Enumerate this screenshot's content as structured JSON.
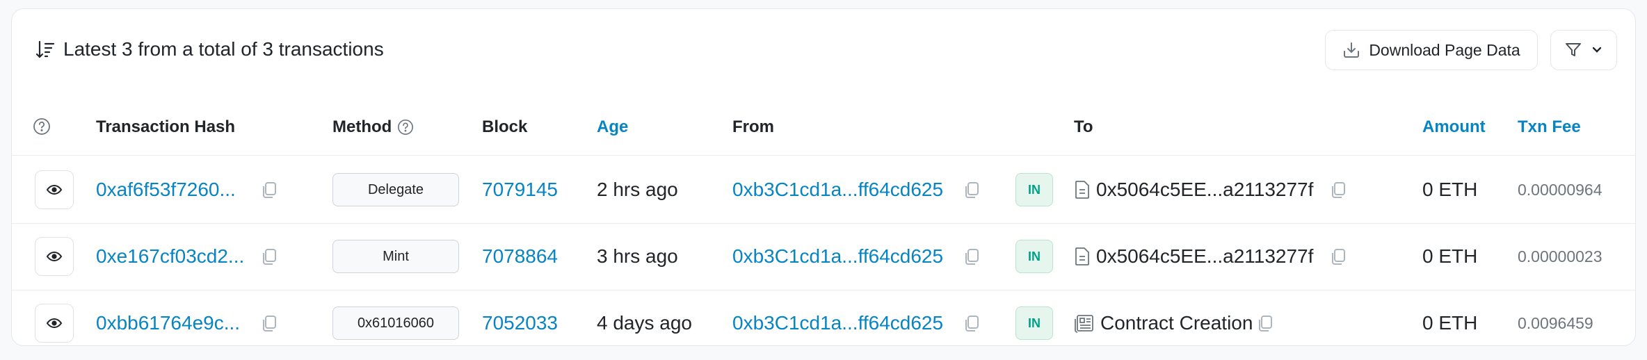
{
  "header": {
    "title": "Latest 3 from a total of 3 transactions",
    "download_label": "Download Page Data"
  },
  "columns": {
    "tx_hash": "Transaction Hash",
    "method": "Method",
    "block": "Block",
    "age": "Age",
    "from": "From",
    "to": "To",
    "amount": "Amount",
    "txn_fee": "Txn Fee"
  },
  "rows": [
    {
      "hash": "0xaf6f53f7260...",
      "method": "Delegate",
      "block": "7079145",
      "age": "2 hrs ago",
      "from": "0xb3C1cd1a...ff64cd625",
      "direction": "IN",
      "to": "0x5064c5EE...a2113277f",
      "to_type": "contract",
      "amount": "0 ETH",
      "fee": "0.00000964"
    },
    {
      "hash": "0xe167cf03cd2...",
      "method": "Mint",
      "block": "7078864",
      "age": "3 hrs ago",
      "from": "0xb3C1cd1a...ff64cd625",
      "direction": "IN",
      "to": "0x5064c5EE...a2113277f",
      "to_type": "contract",
      "amount": "0 ETH",
      "fee": "0.00000023"
    },
    {
      "hash": "0xbb61764e9c...",
      "method": "0x61016060",
      "block": "7052033",
      "age": "4 days ago",
      "from": "0xb3C1cd1a...ff64cd625",
      "direction": "IN",
      "to": "Contract Creation",
      "to_type": "creation",
      "amount": "0 ETH",
      "fee": "0.0096459"
    }
  ],
  "colors": {
    "link": "#0784c3",
    "badge_in_text": "#00a186",
    "badge_in_bg": "#e6f6ef",
    "border": "#e9ecef"
  }
}
